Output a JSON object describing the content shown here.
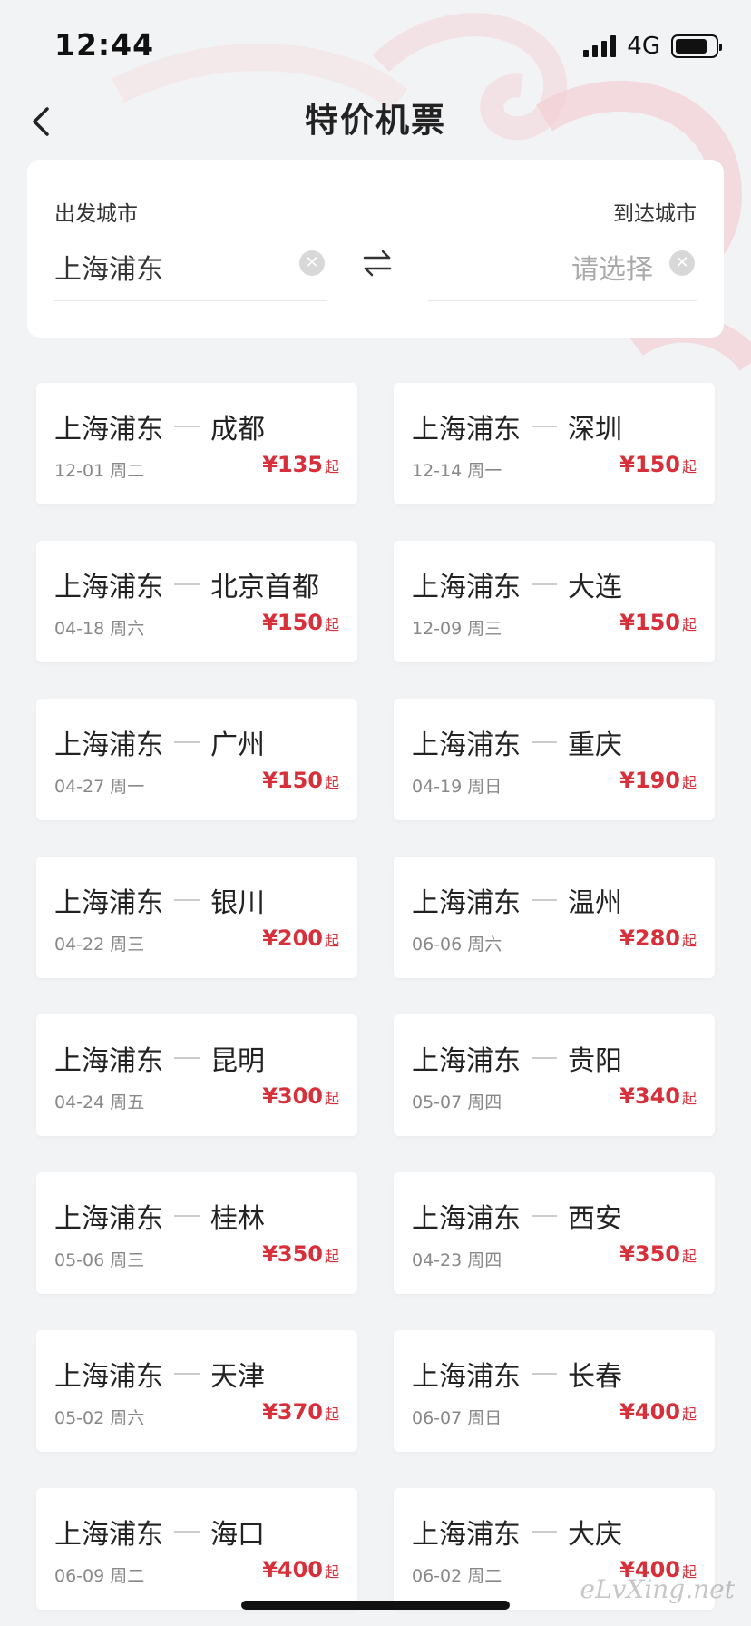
{
  "status": {
    "time": "12:44",
    "network": "4G",
    "battery_level": 0.8
  },
  "nav": {
    "title": "特价机票"
  },
  "selector": {
    "from_label": "出发城市",
    "from_value": "上海浦东",
    "to_label": "到达城市",
    "to_placeholder": "请选择"
  },
  "flights": [
    {
      "origin": "上海浦东",
      "dest": "成都",
      "date": "12-01 周二",
      "price": "¥135",
      "suffix": "起"
    },
    {
      "origin": "上海浦东",
      "dest": "深圳",
      "date": "12-14 周一",
      "price": "¥150",
      "suffix": "起"
    },
    {
      "origin": "上海浦东",
      "dest": "北京首都",
      "date": "04-18 周六",
      "price": "¥150",
      "suffix": "起"
    },
    {
      "origin": "上海浦东",
      "dest": "大连",
      "date": "12-09 周三",
      "price": "¥150",
      "suffix": "起"
    },
    {
      "origin": "上海浦东",
      "dest": "广州",
      "date": "04-27 周一",
      "price": "¥150",
      "suffix": "起"
    },
    {
      "origin": "上海浦东",
      "dest": "重庆",
      "date": "04-19 周日",
      "price": "¥190",
      "suffix": "起"
    },
    {
      "origin": "上海浦东",
      "dest": "银川",
      "date": "04-22 周三",
      "price": "¥200",
      "suffix": "起"
    },
    {
      "origin": "上海浦东",
      "dest": "温州",
      "date": "06-06 周六",
      "price": "¥280",
      "suffix": "起"
    },
    {
      "origin": "上海浦东",
      "dest": "昆明",
      "date": "04-24 周五",
      "price": "¥300",
      "suffix": "起"
    },
    {
      "origin": "上海浦东",
      "dest": "贵阳",
      "date": "05-07 周四",
      "price": "¥340",
      "suffix": "起"
    },
    {
      "origin": "上海浦东",
      "dest": "桂林",
      "date": "05-06 周三",
      "price": "¥350",
      "suffix": "起"
    },
    {
      "origin": "上海浦东",
      "dest": "西安",
      "date": "04-23 周四",
      "price": "¥350",
      "suffix": "起"
    },
    {
      "origin": "上海浦东",
      "dest": "天津",
      "date": "05-02 周六",
      "price": "¥370",
      "suffix": "起"
    },
    {
      "origin": "上海浦东",
      "dest": "长春",
      "date": "06-07 周日",
      "price": "¥400",
      "suffix": "起"
    },
    {
      "origin": "上海浦东",
      "dest": "海口",
      "date": "06-09 周二",
      "price": "¥400",
      "suffix": "起"
    },
    {
      "origin": "上海浦东",
      "dest": "大庆",
      "date": "06-02 周二",
      "price": "¥400",
      "suffix": "起"
    }
  ],
  "watermark": "eLvXing.net",
  "colors": {
    "price": "#d7303a",
    "background": "#f2f3f5",
    "card": "#ffffff"
  }
}
